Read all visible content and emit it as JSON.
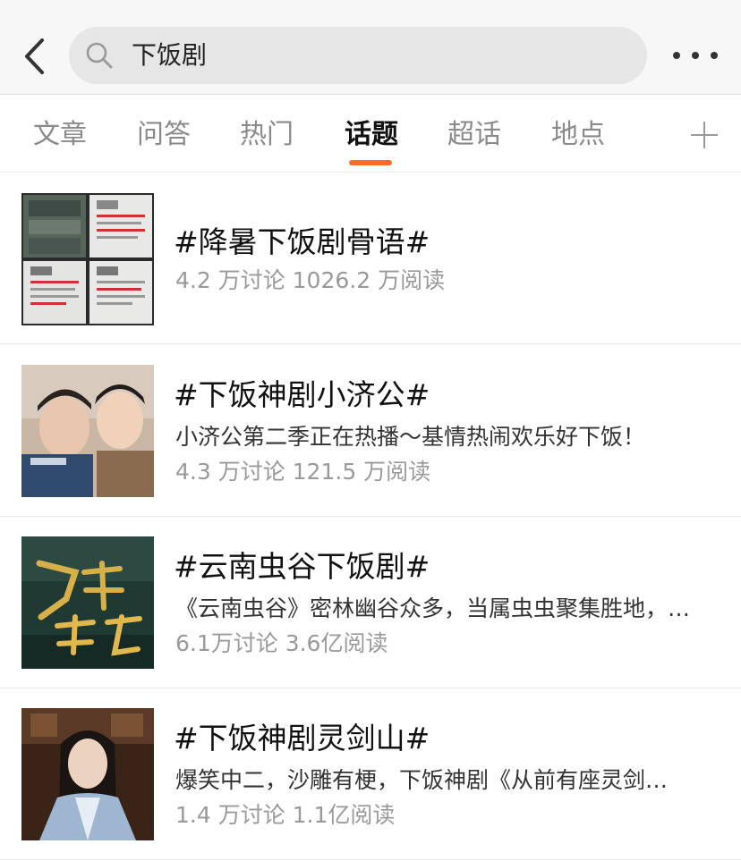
{
  "header": {
    "search_query": "下饭剧"
  },
  "tabs": [
    {
      "label": "文章",
      "active": false
    },
    {
      "label": "问答",
      "active": false
    },
    {
      "label": "热门",
      "active": false
    },
    {
      "label": "话题",
      "active": true
    },
    {
      "label": "超话",
      "active": false
    },
    {
      "label": "地点",
      "active": false
    }
  ],
  "accent_color": "#ff6a2a",
  "topics": [
    {
      "title": "#降暑下饭剧骨语#",
      "description": "",
      "stats": "4.2 万讨论 1026.2 万阅读",
      "thumbnail": "collage-bone-language"
    },
    {
      "title": "#下饭神剧小济公#",
      "description": "小济公第二季正在热播～基情热闹欢乐好下饭！",
      "stats": "4.3 万讨论 121.5 万阅读",
      "thumbnail": "two-actors-portrait"
    },
    {
      "title": "#云南虫谷下饭剧#",
      "description": "《云南虫谷》密林幽谷众多，当属虫虫聚集胜地，…",
      "stats": "6.1万讨论 3.6亿阅读",
      "thumbnail": "yunnan-chonggu-poster"
    },
    {
      "title": "#下饭神剧灵剑山#",
      "description": "爆笑中二，沙雕有梗，下饭神剧《从前有座灵剑…",
      "stats": "1.4 万讨论 1.1亿阅读",
      "thumbnail": "swordsman-portrait"
    }
  ]
}
